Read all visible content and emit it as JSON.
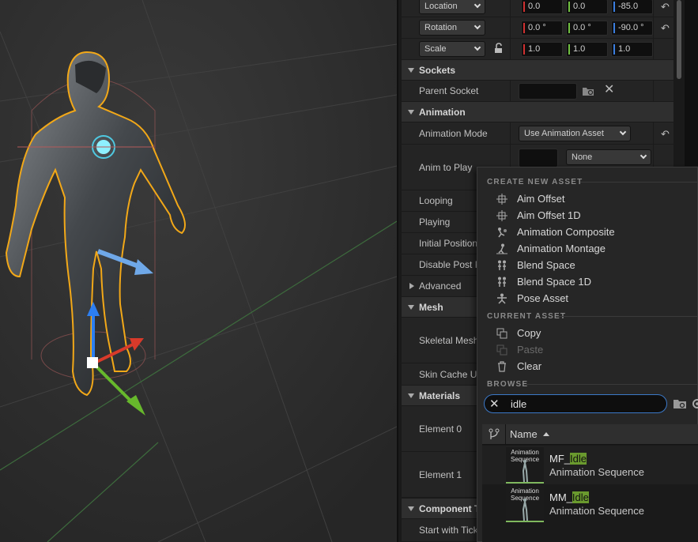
{
  "transform": {
    "location": {
      "label": "Location",
      "x": "0.0",
      "y": "0.0",
      "z": "-85.0"
    },
    "rotation": {
      "label": "Rotation",
      "x": "0.0 °",
      "y": "0.0 °",
      "z": "-90.0 °"
    },
    "scale": {
      "label": "Scale",
      "x": "1.0",
      "y": "1.0",
      "z": "1.0"
    }
  },
  "sockets": {
    "title": "Sockets",
    "parent_socket": "Parent Socket"
  },
  "animation": {
    "title": "Animation",
    "mode_label": "Animation Mode",
    "mode_value": "Use Animation Asset",
    "anim_to_play_label": "Anim to Play",
    "anim_to_play_value": "None",
    "looping": "Looping",
    "playing": "Playing",
    "initial_position": "Initial Position",
    "disable_post": "Disable Post Pr",
    "advanced": "Advanced"
  },
  "mesh": {
    "title": "Mesh",
    "skeletal_mesh": "Skeletal Mesh",
    "skin_cache": "Skin Cache Usa"
  },
  "materials": {
    "title": "Materials",
    "element0": "Element 0",
    "element1": "Element 1"
  },
  "component_tick": {
    "title": "Component Tic",
    "start_with_tick": "Start with Tick"
  },
  "popup": {
    "create_header": "CREATE NEW ASSET",
    "create_items": [
      "Aim Offset",
      "Aim Offset 1D",
      "Animation Composite",
      "Animation Montage",
      "Blend Space",
      "Blend Space 1D",
      "Pose Asset"
    ],
    "current_header": "CURRENT ASSET",
    "current_items": [
      "Copy",
      "Paste",
      "Clear"
    ],
    "browse_header": "BROWSE",
    "search_value": "idle",
    "list_header_name": "Name",
    "assets": [
      {
        "prefix": "MF_",
        "match": "Idle",
        "type": "Animation Sequence",
        "thumb_caption": "Animation Sequence"
      },
      {
        "prefix": "MM_",
        "match": "Idle",
        "type": "Animation Sequence",
        "thumb_caption": "Animation Sequence"
      }
    ]
  },
  "colors": {
    "accent_blue": "#3b78c7",
    "axis_x": "#d03030",
    "axis_y": "#70c040",
    "axis_z": "#3a7ee0",
    "highlight": "#6a9a2e"
  }
}
